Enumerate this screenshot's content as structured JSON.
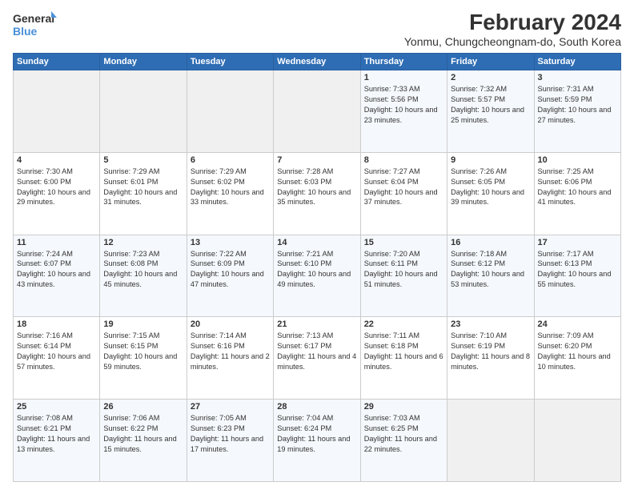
{
  "logo": {
    "line1": "General",
    "line2": "Blue"
  },
  "title": "February 2024",
  "subtitle": "Yonmu, Chungcheongnam-do, South Korea",
  "days_of_week": [
    "Sunday",
    "Monday",
    "Tuesday",
    "Wednesday",
    "Thursday",
    "Friday",
    "Saturday"
  ],
  "weeks": [
    [
      {
        "day": "",
        "sunrise": "",
        "sunset": "",
        "daylight": ""
      },
      {
        "day": "",
        "sunrise": "",
        "sunset": "",
        "daylight": ""
      },
      {
        "day": "",
        "sunrise": "",
        "sunset": "",
        "daylight": ""
      },
      {
        "day": "",
        "sunrise": "",
        "sunset": "",
        "daylight": ""
      },
      {
        "day": "1",
        "sunrise": "Sunrise: 7:33 AM",
        "sunset": "Sunset: 5:56 PM",
        "daylight": "Daylight: 10 hours and 23 minutes."
      },
      {
        "day": "2",
        "sunrise": "Sunrise: 7:32 AM",
        "sunset": "Sunset: 5:57 PM",
        "daylight": "Daylight: 10 hours and 25 minutes."
      },
      {
        "day": "3",
        "sunrise": "Sunrise: 7:31 AM",
        "sunset": "Sunset: 5:59 PM",
        "daylight": "Daylight: 10 hours and 27 minutes."
      }
    ],
    [
      {
        "day": "4",
        "sunrise": "Sunrise: 7:30 AM",
        "sunset": "Sunset: 6:00 PM",
        "daylight": "Daylight: 10 hours and 29 minutes."
      },
      {
        "day": "5",
        "sunrise": "Sunrise: 7:29 AM",
        "sunset": "Sunset: 6:01 PM",
        "daylight": "Daylight: 10 hours and 31 minutes."
      },
      {
        "day": "6",
        "sunrise": "Sunrise: 7:29 AM",
        "sunset": "Sunset: 6:02 PM",
        "daylight": "Daylight: 10 hours and 33 minutes."
      },
      {
        "day": "7",
        "sunrise": "Sunrise: 7:28 AM",
        "sunset": "Sunset: 6:03 PM",
        "daylight": "Daylight: 10 hours and 35 minutes."
      },
      {
        "day": "8",
        "sunrise": "Sunrise: 7:27 AM",
        "sunset": "Sunset: 6:04 PM",
        "daylight": "Daylight: 10 hours and 37 minutes."
      },
      {
        "day": "9",
        "sunrise": "Sunrise: 7:26 AM",
        "sunset": "Sunset: 6:05 PM",
        "daylight": "Daylight: 10 hours and 39 minutes."
      },
      {
        "day": "10",
        "sunrise": "Sunrise: 7:25 AM",
        "sunset": "Sunset: 6:06 PM",
        "daylight": "Daylight: 10 hours and 41 minutes."
      }
    ],
    [
      {
        "day": "11",
        "sunrise": "Sunrise: 7:24 AM",
        "sunset": "Sunset: 6:07 PM",
        "daylight": "Daylight: 10 hours and 43 minutes."
      },
      {
        "day": "12",
        "sunrise": "Sunrise: 7:23 AM",
        "sunset": "Sunset: 6:08 PM",
        "daylight": "Daylight: 10 hours and 45 minutes."
      },
      {
        "day": "13",
        "sunrise": "Sunrise: 7:22 AM",
        "sunset": "Sunset: 6:09 PM",
        "daylight": "Daylight: 10 hours and 47 minutes."
      },
      {
        "day": "14",
        "sunrise": "Sunrise: 7:21 AM",
        "sunset": "Sunset: 6:10 PM",
        "daylight": "Daylight: 10 hours and 49 minutes."
      },
      {
        "day": "15",
        "sunrise": "Sunrise: 7:20 AM",
        "sunset": "Sunset: 6:11 PM",
        "daylight": "Daylight: 10 hours and 51 minutes."
      },
      {
        "day": "16",
        "sunrise": "Sunrise: 7:18 AM",
        "sunset": "Sunset: 6:12 PM",
        "daylight": "Daylight: 10 hours and 53 minutes."
      },
      {
        "day": "17",
        "sunrise": "Sunrise: 7:17 AM",
        "sunset": "Sunset: 6:13 PM",
        "daylight": "Daylight: 10 hours and 55 minutes."
      }
    ],
    [
      {
        "day": "18",
        "sunrise": "Sunrise: 7:16 AM",
        "sunset": "Sunset: 6:14 PM",
        "daylight": "Daylight: 10 hours and 57 minutes."
      },
      {
        "day": "19",
        "sunrise": "Sunrise: 7:15 AM",
        "sunset": "Sunset: 6:15 PM",
        "daylight": "Daylight: 10 hours and 59 minutes."
      },
      {
        "day": "20",
        "sunrise": "Sunrise: 7:14 AM",
        "sunset": "Sunset: 6:16 PM",
        "daylight": "Daylight: 11 hours and 2 minutes."
      },
      {
        "day": "21",
        "sunrise": "Sunrise: 7:13 AM",
        "sunset": "Sunset: 6:17 PM",
        "daylight": "Daylight: 11 hours and 4 minutes."
      },
      {
        "day": "22",
        "sunrise": "Sunrise: 7:11 AM",
        "sunset": "Sunset: 6:18 PM",
        "daylight": "Daylight: 11 hours and 6 minutes."
      },
      {
        "day": "23",
        "sunrise": "Sunrise: 7:10 AM",
        "sunset": "Sunset: 6:19 PM",
        "daylight": "Daylight: 11 hours and 8 minutes."
      },
      {
        "day": "24",
        "sunrise": "Sunrise: 7:09 AM",
        "sunset": "Sunset: 6:20 PM",
        "daylight": "Daylight: 11 hours and 10 minutes."
      }
    ],
    [
      {
        "day": "25",
        "sunrise": "Sunrise: 7:08 AM",
        "sunset": "Sunset: 6:21 PM",
        "daylight": "Daylight: 11 hours and 13 minutes."
      },
      {
        "day": "26",
        "sunrise": "Sunrise: 7:06 AM",
        "sunset": "Sunset: 6:22 PM",
        "daylight": "Daylight: 11 hours and 15 minutes."
      },
      {
        "day": "27",
        "sunrise": "Sunrise: 7:05 AM",
        "sunset": "Sunset: 6:23 PM",
        "daylight": "Daylight: 11 hours and 17 minutes."
      },
      {
        "day": "28",
        "sunrise": "Sunrise: 7:04 AM",
        "sunset": "Sunset: 6:24 PM",
        "daylight": "Daylight: 11 hours and 19 minutes."
      },
      {
        "day": "29",
        "sunrise": "Sunrise: 7:03 AM",
        "sunset": "Sunset: 6:25 PM",
        "daylight": "Daylight: 11 hours and 22 minutes."
      },
      {
        "day": "",
        "sunrise": "",
        "sunset": "",
        "daylight": ""
      },
      {
        "day": "",
        "sunrise": "",
        "sunset": "",
        "daylight": ""
      }
    ]
  ]
}
